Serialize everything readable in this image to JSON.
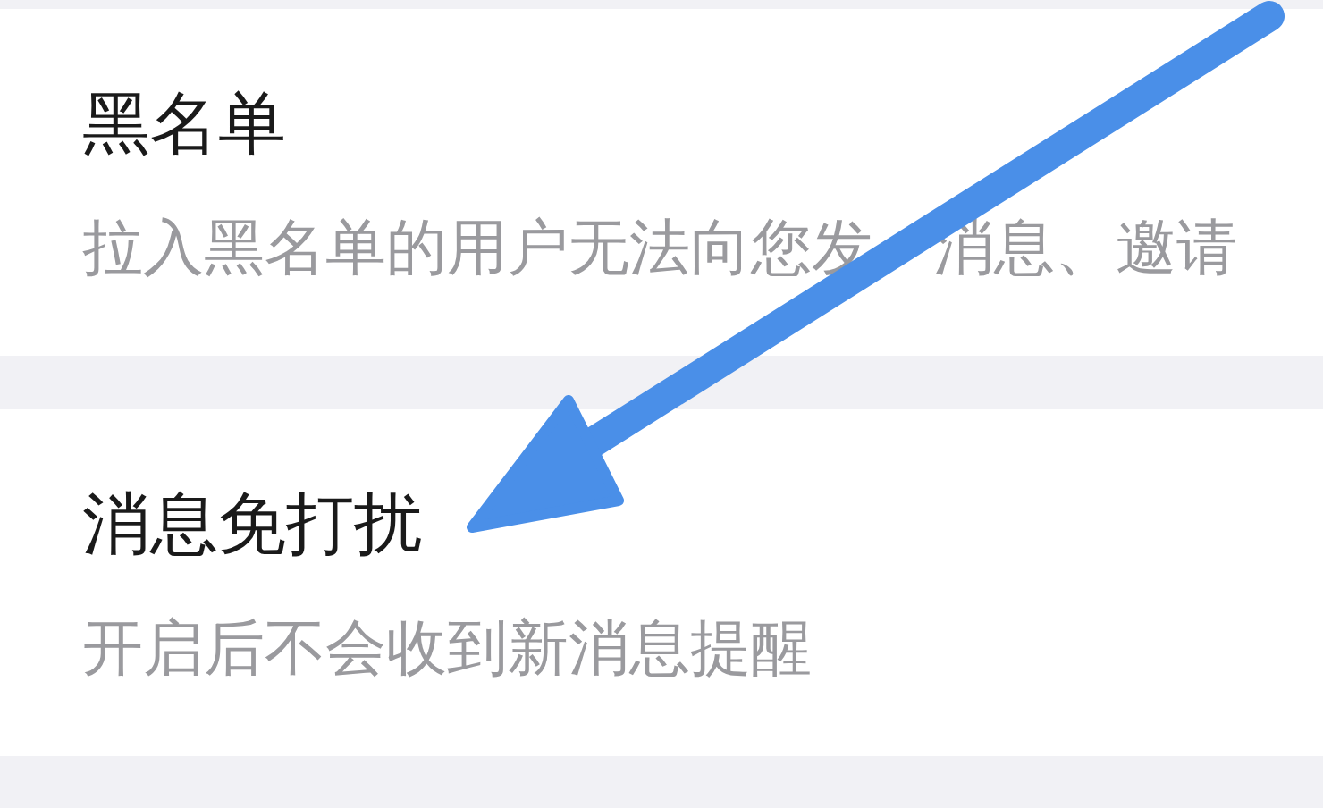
{
  "sections": [
    {
      "title": "黑名单",
      "description_parts": [
        "拉入黑名单的用户无法向您发",
        "消息、邀请"
      ]
    },
    {
      "title": "消息免打扰",
      "description_parts": [
        "开启后不会收到新消息提醒"
      ]
    }
  ]
}
